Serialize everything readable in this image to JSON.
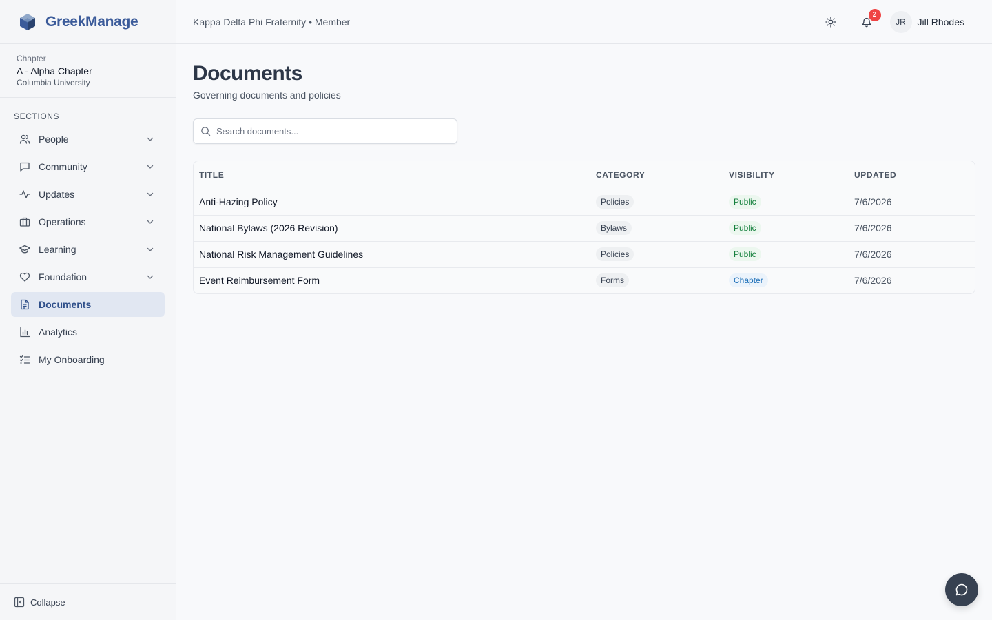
{
  "app": {
    "name": "GreekManage"
  },
  "chapter": {
    "label": "Chapter",
    "name": "A - Alpha Chapter",
    "school": "Columbia University"
  },
  "sidebar": {
    "sections_label": "SECTIONS",
    "items": [
      {
        "label": "People",
        "icon": "people-icon",
        "expandable": true
      },
      {
        "label": "Community",
        "icon": "chat-icon",
        "expandable": true
      },
      {
        "label": "Updates",
        "icon": "activity-icon",
        "expandable": true
      },
      {
        "label": "Operations",
        "icon": "briefcase-icon",
        "expandable": true
      },
      {
        "label": "Learning",
        "icon": "graduation-cap-icon",
        "expandable": true
      },
      {
        "label": "Foundation",
        "icon": "heart-icon",
        "expandable": true
      },
      {
        "label": "Documents",
        "icon": "file-text-icon",
        "active": true
      },
      {
        "label": "Analytics",
        "icon": "bar-chart-icon"
      },
      {
        "label": "My Onboarding",
        "icon": "checklist-icon"
      }
    ],
    "collapse_label": "Collapse"
  },
  "header": {
    "org_line": "Kappa Delta Phi Fraternity • Member",
    "notifications_count": "2",
    "user_initials": "JR",
    "user_name": "Jill Rhodes"
  },
  "page": {
    "title": "Documents",
    "subtitle": "Governing documents and policies",
    "search_placeholder": "Search documents..."
  },
  "table": {
    "columns": [
      "TITLE",
      "CATEGORY",
      "VISIBILITY",
      "UPDATED"
    ],
    "rows": [
      {
        "title": "Anti-Hazing Policy",
        "category": "Policies",
        "visibility": "Public",
        "updated": "7/6/2026"
      },
      {
        "title": "National Bylaws (2026 Revision)",
        "category": "Bylaws",
        "visibility": "Public",
        "updated": "7/6/2026"
      },
      {
        "title": "National Risk Management Guidelines",
        "category": "Policies",
        "visibility": "Public",
        "updated": "7/6/2026"
      },
      {
        "title": "Event Reimbursement Form",
        "category": "Forms",
        "visibility": "Chapter",
        "updated": "7/6/2026"
      }
    ]
  },
  "colors": {
    "brand": "#3b5b9a",
    "active_bg": "#e1e7f2",
    "badge": "#ef4444",
    "public_text": "#15803d",
    "chapter_text": "#1d6fb8",
    "chat_button": "#374151"
  }
}
